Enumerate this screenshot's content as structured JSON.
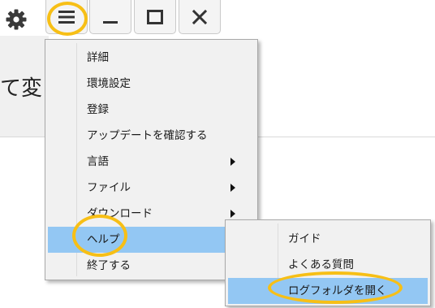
{
  "app": {
    "background_text": "て変"
  },
  "titlebar": {
    "settings_icon": "gear-icon",
    "menu_icon": "hamburger-icon",
    "minimize_icon": "minimize-icon",
    "maximize_icon": "maximize-icon",
    "close_icon": "close-icon"
  },
  "menu": {
    "items": [
      {
        "label": "詳細"
      },
      {
        "label": "環境設定"
      },
      {
        "label": "登録"
      },
      {
        "label": "アップデートを確認する"
      },
      {
        "label": "言語"
      },
      {
        "label": "ファイル"
      },
      {
        "label": "ダウンロード"
      },
      {
        "label": "ヘルプ"
      },
      {
        "label": "終了する"
      }
    ]
  },
  "submenu": {
    "items": [
      {
        "label": "ガイド"
      },
      {
        "label": "よくある質問"
      },
      {
        "label": "ログフォルダを開く"
      }
    ]
  },
  "colors": {
    "highlight_ring": "#f7bf16",
    "menu_selection": "#93c7f3",
    "menu_background": "#f1f1f1"
  }
}
